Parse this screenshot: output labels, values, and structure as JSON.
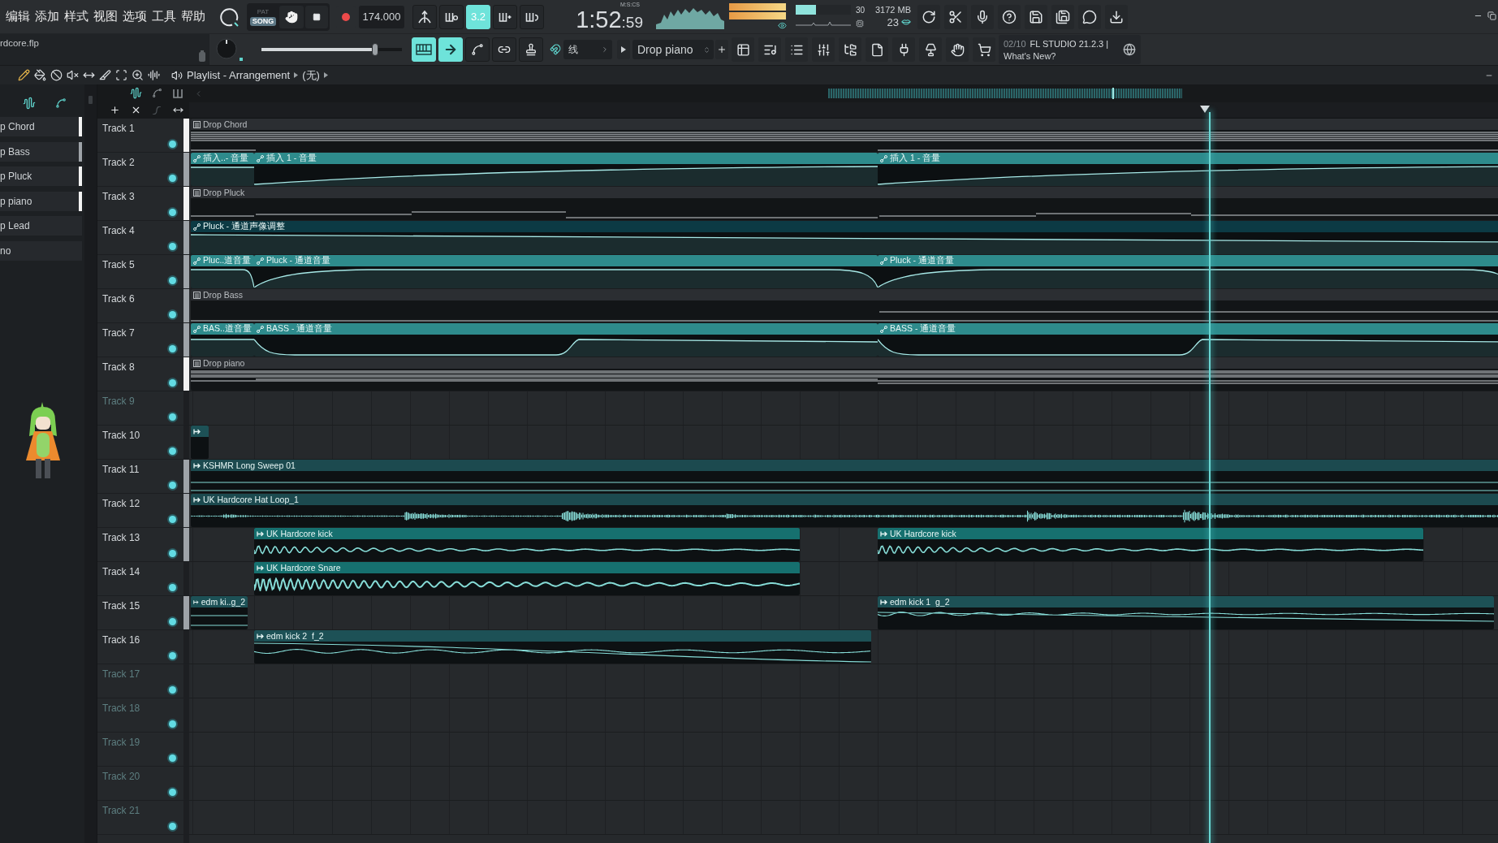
{
  "menu": [
    "编辑",
    "添加",
    "样式",
    "视图",
    "选项",
    "工具",
    "帮助"
  ],
  "transport": {
    "modes": [
      {
        "label": "PAT",
        "selected": false
      },
      {
        "label": "SONG",
        "selected": true
      }
    ],
    "tempo": "174.000"
  },
  "toggles": [
    {
      "on": false
    },
    {
      "on": false
    },
    {
      "label": "3.2",
      "on": true
    },
    {
      "on": false
    },
    {
      "on": false
    }
  ],
  "clock": {
    "time": "1:52",
    "centiseconds": ":59",
    "format": "M:S:CS"
  },
  "peak_meters": [
    {
      "level": 0.98
    },
    {
      "level": 0.98
    }
  ],
  "cpu": {
    "reading": "30",
    "level": 0.37
  },
  "memory": {
    "reading": "3172 MB",
    "polyphony": "23"
  },
  "project": {
    "file": "rdcore.flp"
  },
  "master_volume": {
    "level": 0.81
  },
  "tool_toggles": [
    {
      "on": true
    },
    {
      "on": true
    },
    {
      "on": false
    },
    {
      "on": false
    },
    {
      "on": false
    }
  ],
  "snap": {
    "value": "线"
  },
  "pattern_selector": {
    "value": "Drop piano"
  },
  "news": {
    "counter": "02/10",
    "title": "FL STUDIO 21.2.3 |",
    "link": "What's New?"
  },
  "breadcrumb": [
    "Playlist - Arrangement",
    "(无)"
  ],
  "picker": [
    {
      "label": "p Chord",
      "color": "#f2f2f2"
    },
    {
      "label": "p Bass",
      "color": "#9ea3a8"
    },
    {
      "label": "p Pluck",
      "color": "#f2f2f2"
    },
    {
      "label": "p piano",
      "color": "#f2f2f2"
    },
    {
      "label": "p Lead"
    },
    {
      "label": "no"
    }
  ],
  "tracks": [
    {
      "name": "Track 1",
      "enabled": true,
      "color": "#f2f2f2",
      "clips": [
        {
          "kind": "pattern",
          "label": "Drop Chord",
          "color": "#2b2e32"
        }
      ]
    },
    {
      "name": "Track 2",
      "enabled": true,
      "color": "#9ea3a8",
      "clips": [
        {
          "kind": "automation",
          "label": "插入..- 音量",
          "color": "#2e8b8c"
        },
        {
          "kind": "automation",
          "label": "插入 1 - 音量",
          "color": "#2e8b8c"
        },
        {
          "kind": "automation",
          "label": "插入 1 - 音量",
          "color": "#2e8b8c"
        }
      ]
    },
    {
      "name": "Track 3",
      "enabled": true,
      "color": "#f2f2f2",
      "clips": [
        {
          "kind": "pattern",
          "label": "Drop Pluck",
          "color": "#2b2e32"
        }
      ]
    },
    {
      "name": "Track 4",
      "enabled": true,
      "color": "#9ea3a8",
      "clips": [
        {
          "kind": "automation",
          "label": "Pluck - 通道声像调整",
          "color": "#0c3a44"
        }
      ]
    },
    {
      "name": "Track 5",
      "enabled": true,
      "color": "#9ea3a8",
      "clips": [
        {
          "kind": "automation",
          "label": "Pluc..道音量",
          "color": "#2e8b8c"
        },
        {
          "kind": "automation",
          "label": "Pluck - 通道音量",
          "color": "#2e8b8c"
        },
        {
          "kind": "automation",
          "label": "Pluck - 通道音量",
          "color": "#2e8b8c"
        }
      ]
    },
    {
      "name": "Track 6",
      "enabled": true,
      "color": "#9ea3a8",
      "clips": [
        {
          "kind": "pattern",
          "label": "Drop Bass",
          "color": "#2b2e32"
        }
      ]
    },
    {
      "name": "Track 7",
      "enabled": true,
      "color": "#9ea3a8",
      "clips": [
        {
          "kind": "automation",
          "label": "BAS..道音量",
          "color": "#2e8b8c"
        },
        {
          "kind": "automation",
          "label": "BASS - 通道音量",
          "color": "#2e8b8c"
        },
        {
          "kind": "automation",
          "label": "BASS - 通道音量",
          "color": "#2e8b8c"
        }
      ]
    },
    {
      "name": "Track 8",
      "enabled": true,
      "color": "#f2f2f2",
      "clips": [
        {
          "kind": "pattern",
          "label": "Drop piano",
          "color": "#2b2e32"
        }
      ]
    },
    {
      "name": "Track 9",
      "enabled": true
    },
    {
      "name": "Track 10",
      "enabled": true,
      "clips": [
        {
          "kind": "audio",
          "color": "#1d5156"
        }
      ]
    },
    {
      "name": "Track 11",
      "enabled": true,
      "color": "#9ea3a8",
      "clips": [
        {
          "kind": "audio",
          "label": "KSHMR Long Sweep 01",
          "color": "#1c4a4f"
        }
      ]
    },
    {
      "name": "Track 12",
      "enabled": true,
      "color": "#9ea3a8",
      "clips": [
        {
          "kind": "audio",
          "label": "UK Hardcore Hat Loop_1",
          "color": "#1c4a4f"
        }
      ]
    },
    {
      "name": "Track 13",
      "enabled": true,
      "color": "#9ea3a8",
      "clips": [
        {
          "kind": "audio",
          "label": "UK Hardcore kick",
          "color": "#16706f"
        },
        {
          "kind": "audio",
          "label": "UK Hardcore kick",
          "color": "#16706f"
        }
      ]
    },
    {
      "name": "Track 14",
      "enabled": true,
      "clips": [
        {
          "kind": "audio",
          "label": "UK Hardcore Snare",
          "color": "#16706f"
        }
      ]
    },
    {
      "name": "Track 15",
      "enabled": true,
      "color": "#9ea3a8",
      "clips": [
        {
          "kind": "audio",
          "label": "edm ki..g_2",
          "color": "#1d5156"
        },
        {
          "kind": "audio",
          "label": "edm kick 1  g_2",
          "color": "#1d5156"
        }
      ]
    },
    {
      "name": "Track 16",
      "enabled": true,
      "clips": [
        {
          "kind": "audio",
          "label": "edm kick 2  f_2",
          "color": "#1d5156"
        }
      ]
    },
    {
      "name": "Track 17",
      "enabled": true
    },
    {
      "name": "Track 18",
      "enabled": true
    },
    {
      "name": "Track 19",
      "enabled": true
    },
    {
      "name": "Track 20",
      "enabled": true
    },
    {
      "name": "Track 21",
      "enabled": true
    }
  ]
}
